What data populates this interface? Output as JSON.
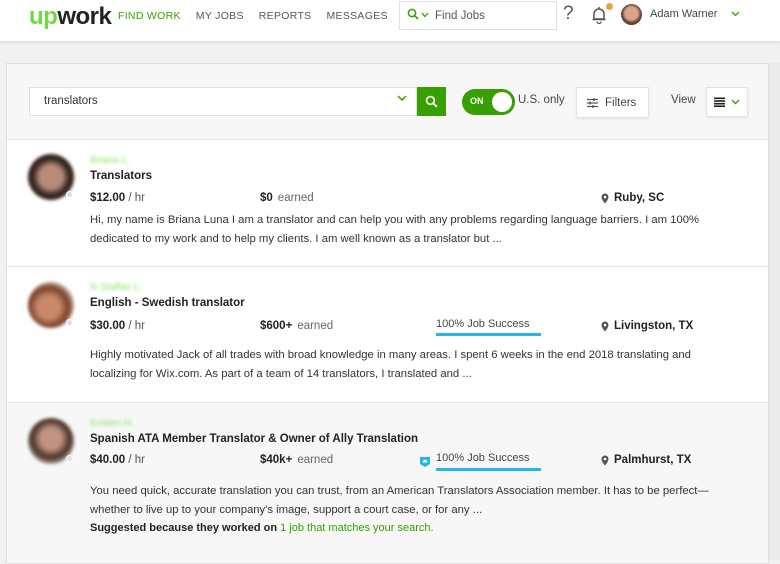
{
  "nav": {
    "logo_up": "up",
    "logo_work": "work",
    "links": [
      "FIND WORK",
      "MY JOBS",
      "REPORTS",
      "MESSAGES"
    ],
    "active_link": "FIND WORK",
    "search_placeholder": "Find Jobs",
    "help_label": "?",
    "user_name": "Adam Warner",
    "notification_dot": true
  },
  "search": {
    "query": "translators",
    "us_only_toggle": "ON",
    "us_only_label": "U.S. only",
    "filters_label": "Filters",
    "view_label": "View"
  },
  "results": [
    {
      "name": "Briana L.",
      "title": "Translators",
      "rate": "$12.00",
      "rate_unit": " / hr",
      "earned": "$0",
      "earned_label": "earned",
      "job_success": "",
      "location": "Ruby, SC",
      "description": "Hi, my name is Briana Luna I am a translator and can help you with any problems regarding language barriers. I am 100% dedicated to my work and to help my clients. I am well known as a translator but ..."
    },
    {
      "name": "N Staffan L.",
      "title": "English - Swedish translator",
      "rate": "$30.00",
      "rate_unit": " / hr",
      "earned": "$600+",
      "earned_label": "earned",
      "job_success": "100% Job Success",
      "location": "Livingston, TX",
      "description": "Highly motivated Jack of all trades with broad knowledge in many areas. I spent 6 weeks in the end 2018 translating and localizing for Wix.com. As part of a team of 14 translators, I translated and ..."
    },
    {
      "name": "Kristen H.",
      "title": "Spanish ATA Member Translator & Owner of Ally Translation",
      "rate": "$40.00",
      "rate_unit": " / hr",
      "earned": "$40k+",
      "earned_label": "earned",
      "job_success": "100% Job Success",
      "top_rated_badge": true,
      "location": "Palmhurst, TX",
      "description": "You need quick, accurate translation you can trust, from an American Translators Association member. It has to be perfect—whether to live up to your company's image, support a court case, or for any ...",
      "suggestion_prefix": "Suggested because they worked on ",
      "suggestion_link": "1 job that matches your search."
    }
  ],
  "colors": {
    "brand_green": "#37a000",
    "logo_green": "#6fda44",
    "job_success_blue": "#23b7e5",
    "notification": "#e8a33b"
  }
}
